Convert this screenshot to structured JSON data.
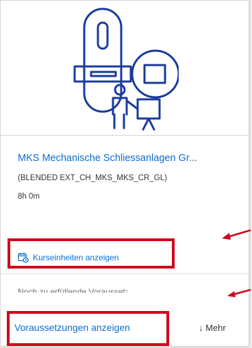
{
  "course": {
    "title": "MKS Mechanische Schliessanlagen Gr...",
    "code": "(BLENDED EXT_CH_MKS_MKS_CR_GL)",
    "duration": "8h 0m"
  },
  "actions": {
    "units_link": "Kurseinheiten anzeigen",
    "prereq_partial": "Noch zu erfüllende Voraussetz...",
    "prereq_link": "Voraussetzungen anzeigen",
    "more": "↓ Mehr"
  },
  "icons": {
    "illustration": "key-lock-teacher-icon",
    "calendar": "calendar-clock-icon",
    "arrow": "red-arrow-icon"
  },
  "colors": {
    "link": "#0a6ed1",
    "illustration": "#1a3a9c",
    "highlight": "#d0021b"
  }
}
